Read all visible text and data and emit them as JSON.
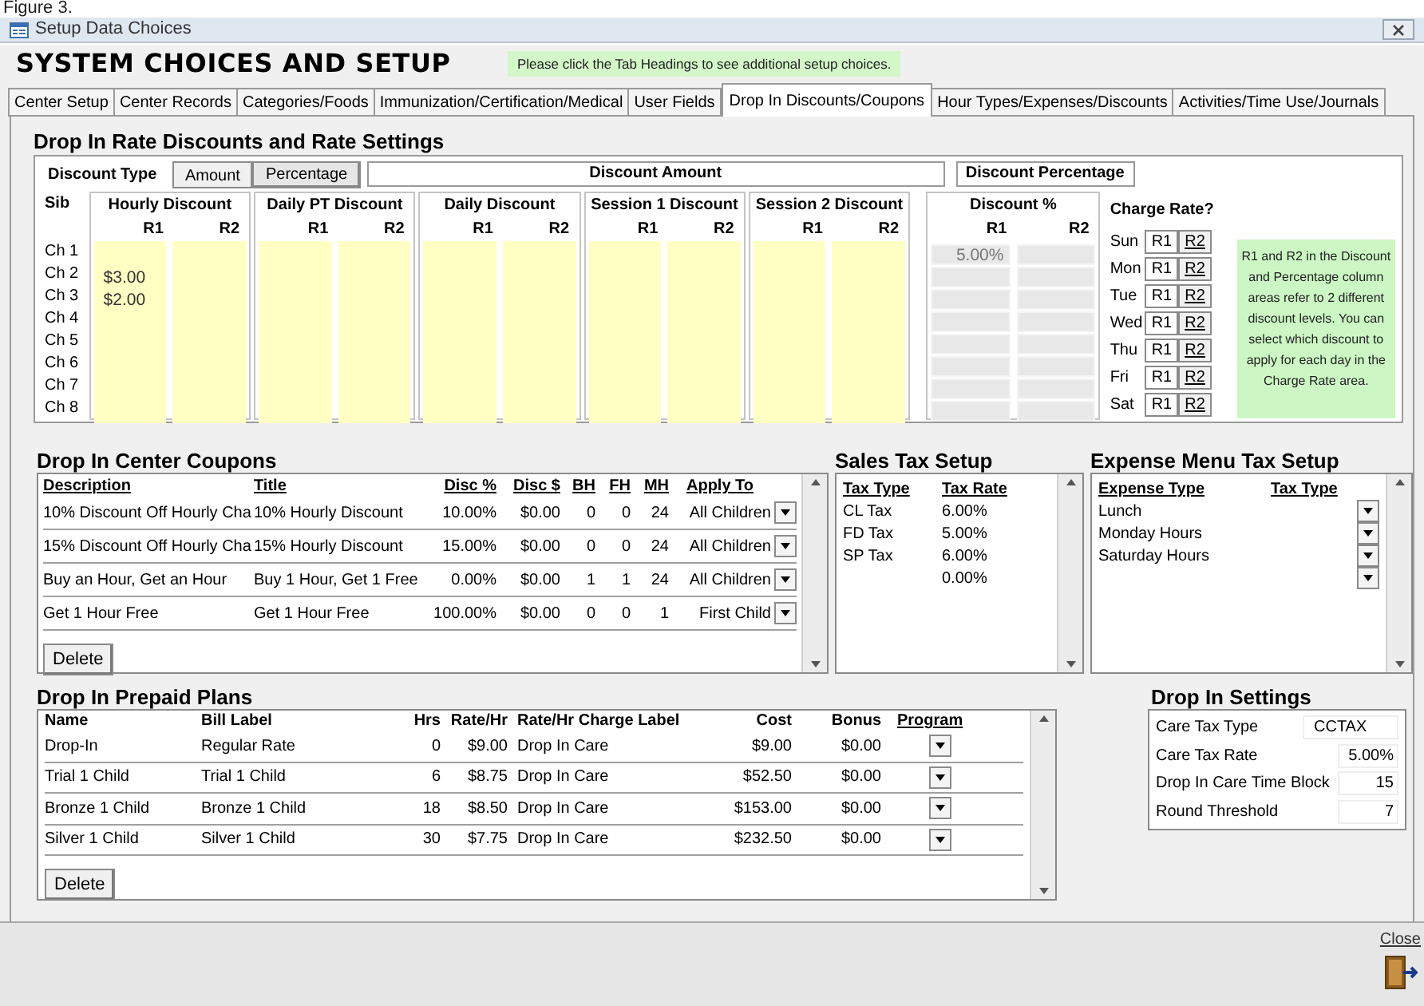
{
  "caption": "Figure 3.",
  "window": {
    "title": "Setup Data Choices"
  },
  "heading": "SYSTEM CHOICES AND SETUP",
  "hint": "Please click the Tab Headings to see additional setup choices.",
  "tabs": [
    {
      "label": "Center Setup",
      "selected": false
    },
    {
      "label": "Center Records",
      "selected": false
    },
    {
      "label": "Categories/Foods",
      "selected": false
    },
    {
      "label": "Immunization/Certification/Medical",
      "selected": false
    },
    {
      "label": "User Fields",
      "selected": false
    },
    {
      "label": "Drop In Discounts/Coupons",
      "selected": true
    },
    {
      "label": "Hour Types/Expenses/Discounts",
      "selected": false
    },
    {
      "label": "Activities/Time Use/Journals",
      "selected": false
    }
  ],
  "rate_section": {
    "title": "Drop In Rate Discounts and Rate Settings",
    "discount_type_label": "Discount Type",
    "type_buttons": [
      {
        "label": "Amount",
        "selected": true
      },
      {
        "label": "Percentage",
        "selected": false
      }
    ],
    "amount_header": "Discount Amount",
    "percent_header": "Discount Percentage",
    "sib_label": "Sib",
    "children": [
      {
        "label": "Ch 1",
        "percent_r1": "5.00%"
      },
      {
        "label": "Ch 2",
        "hourly_r1": "$3.00"
      },
      {
        "label": "Ch 3",
        "hourly_r1": "$2.00"
      },
      {
        "label": "Ch 4"
      },
      {
        "label": "Ch 5"
      },
      {
        "label": "Ch 6"
      },
      {
        "label": "Ch 7"
      },
      {
        "label": "Ch 8"
      }
    ],
    "groups": [
      {
        "title": "Hourly Discount",
        "r1_label": "R1",
        "r2_label": "R2"
      },
      {
        "title": "Daily PT Discount",
        "r1_label": "R1",
        "r2_label": "R2"
      },
      {
        "title": "Daily Discount",
        "r1_label": "R1",
        "r2_label": "R2"
      },
      {
        "title": "Session 1 Discount",
        "r1_label": "R1",
        "r2_label": "R2"
      },
      {
        "title": "Session 2 Discount",
        "r1_label": "R1",
        "r2_label": "R2"
      }
    ],
    "percent_group": {
      "title": "Discount %",
      "r1_label": "R1",
      "r2_label": "R2"
    },
    "charge_rate": {
      "title": "Charge Rate?",
      "days": [
        {
          "label": "Sun",
          "options": [
            "R1",
            "R2"
          ]
        },
        {
          "label": "Mon",
          "options": [
            "R1",
            "R2"
          ]
        },
        {
          "label": "Tue",
          "options": [
            "R1",
            "R2"
          ]
        },
        {
          "label": "Wed",
          "options": [
            "R1",
            "R2"
          ]
        },
        {
          "label": "Thu",
          "options": [
            "R1",
            "R2"
          ]
        },
        {
          "label": "Fri",
          "options": [
            "R1",
            "R2"
          ]
        },
        {
          "label": "Sat",
          "options": [
            "R1",
            "R2"
          ]
        }
      ]
    },
    "note": "R1 and R2 in the Discount and Percentage column areas refer to 2 different discount levels. You can select which discount to apply for each day in the Charge Rate area."
  },
  "coupons": {
    "title": "Drop In Center Coupons",
    "columns": [
      "Description",
      "Title",
      "Disc %",
      "Disc $",
      "BH",
      "FH",
      "MH",
      "Apply To"
    ],
    "rows": [
      [
        "10% Discount Off Hourly Cha",
        "10% Hourly Discount",
        "10.00%",
        "$0.00",
        "0",
        "0",
        "24",
        "All Children"
      ],
      [
        "15% Discount Off Hourly Cha",
        "15% Hourly Discount",
        "15.00%",
        "$0.00",
        "0",
        "0",
        "24",
        "All Children"
      ],
      [
        "Buy an Hour, Get an Hour",
        "Buy 1 Hour, Get 1 Free",
        "0.00%",
        "$0.00",
        "1",
        "1",
        "24",
        "All Children"
      ],
      [
        "Get 1 Hour Free",
        "Get 1 Hour Free",
        "100.00%",
        "$0.00",
        "0",
        "0",
        "1",
        "First Child"
      ]
    ],
    "delete": "Delete"
  },
  "sales_tax": {
    "title": "Sales Tax Setup",
    "columns": [
      "Tax Type",
      "Tax Rate"
    ],
    "rows": [
      {
        "tax_type": "CL Tax",
        "tax_rate": "6.00%"
      },
      {
        "tax_type": "FD Tax",
        "tax_rate": "5.00%"
      },
      {
        "tax_type": "SP Tax",
        "tax_rate": "6.00%"
      },
      {
        "tax_rate": "0.00%"
      }
    ]
  },
  "expense_tax": {
    "title": "Expense Menu Tax Setup",
    "columns": [
      "Expense Type",
      "Tax Type"
    ],
    "rows": [
      "Lunch",
      "Monday Hours",
      "Saturday Hours"
    ]
  },
  "prepaid": {
    "title": "Drop In Prepaid Plans",
    "columns": [
      "Name",
      "Bill Label",
      "Hrs",
      "Rate/Hr",
      "Rate/Hr Charge Label",
      "Cost",
      "Bonus",
      "Program"
    ],
    "rows": [
      [
        "Drop-In",
        "Regular Rate",
        "0",
        "$9.00",
        "Drop In Care",
        "$9.00",
        "$0.00"
      ],
      [
        "Trial 1 Child",
        "Trial 1 Child",
        "6",
        "$8.75",
        "Drop In Care",
        "$52.50",
        "$0.00"
      ],
      [
        "Bronze 1 Child",
        "Bronze 1 Child",
        "18",
        "$8.50",
        "Drop In Care",
        "$153.00",
        "$0.00"
      ],
      [
        "Silver 1 Child",
        "Silver 1 Child",
        "30",
        "$7.75",
        "Drop In Care",
        "$232.50",
        "$0.00"
      ]
    ],
    "delete": "Delete"
  },
  "settings": {
    "title": "Drop In Settings",
    "fields": [
      {
        "label": "Care Tax Type",
        "value": "CCTAX",
        "kind": "text"
      },
      {
        "label": "Care Tax Rate",
        "value": "5.00%",
        "kind": "number"
      },
      {
        "label": "Drop In Care Time Block",
        "value": "15",
        "kind": "number"
      },
      {
        "label": "Round Threshold",
        "value": "7",
        "kind": "number"
      }
    ]
  },
  "close": "Close"
}
